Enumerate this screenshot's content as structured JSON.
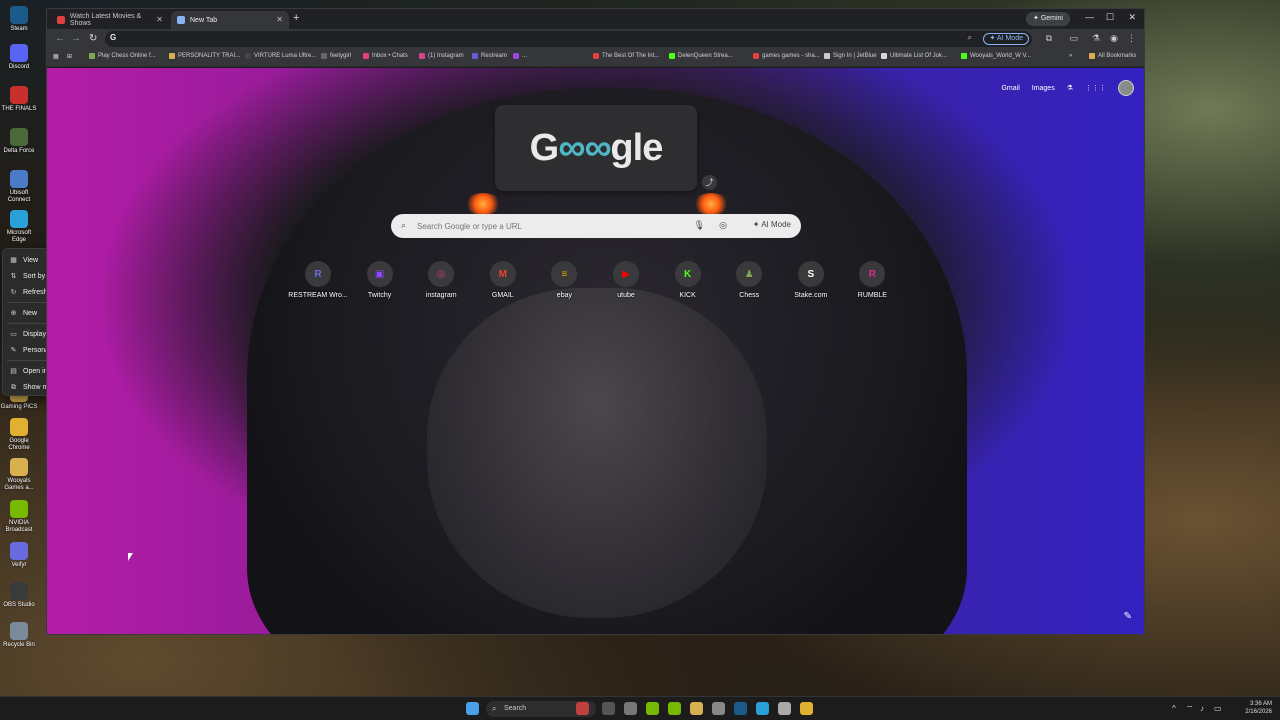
{
  "desktop": {
    "icons": [
      {
        "label": "Steam",
        "color": "#1b5b8a",
        "name": "steam-icon"
      },
      {
        "label": "Discord",
        "color": "#5865f2",
        "name": "discord-icon"
      },
      {
        "label": "THE FINALS",
        "color": "#c9302c",
        "name": "the-finals-icon"
      },
      {
        "label": "Delta Force",
        "color": "#4a6a3a",
        "name": "delta-force-icon"
      },
      {
        "label": "Ubisoft Connect",
        "color": "#4a7ac8",
        "name": "ubisoft-icon"
      },
      {
        "label": "Microsoft Edge",
        "color": "#2aa0d8",
        "name": "edge-icon"
      },
      {
        "label": "Gaming PICS",
        "color": "#d8b050",
        "name": "folder-icon"
      },
      {
        "label": "Google Chrome",
        "color": "#e0b030",
        "name": "chrome-icon"
      },
      {
        "label": "Wooyals Games a...",
        "color": "#d8b050",
        "name": "folder-icon"
      },
      {
        "label": "NVIDIA Broadcast",
        "color": "#76b900",
        "name": "nvidia-icon"
      },
      {
        "label": "Veifyr",
        "color": "#6a6ae0",
        "name": "app-icon"
      },
      {
        "label": "OBS Studio",
        "color": "#3a3a3a",
        "name": "obs-icon"
      },
      {
        "label": "Recycle Bin",
        "color": "#7a8a9a",
        "name": "recycle-bin-icon"
      }
    ]
  },
  "context_menu": {
    "items": [
      {
        "label": "View",
        "icon": "▦",
        "arrow": true
      },
      {
        "label": "Sort by",
        "icon": "⇅",
        "arrow": true
      },
      {
        "label": "Refresh",
        "icon": "↻",
        "arrow": false
      },
      {
        "label": "New",
        "icon": "⊕",
        "arrow": true
      },
      {
        "label": "Display settings",
        "icon": "▭",
        "arrow": false
      },
      {
        "label": "Personalize",
        "icon": "✎",
        "arrow": false
      },
      {
        "label": "Open in Terminal",
        "icon": "▤",
        "arrow": false
      },
      {
        "label": "Show more options",
        "icon": "⧉",
        "arrow": false
      }
    ]
  },
  "browser": {
    "tabs": [
      {
        "title": "Watch Latest Movies & Shows",
        "favicon_color": "#e04040"
      },
      {
        "title": "New Tab",
        "favicon_color": "#8ab4f8"
      }
    ],
    "gemini_label": "Gemini",
    "omnibox_value": "",
    "ai_mode_top": "AI Mode",
    "bookmarks": [
      {
        "label": "Play Chess Online f...",
        "color": "#7fa650"
      },
      {
        "label": "PERSONALITY TRAI...",
        "color": "#d8b050"
      },
      {
        "label": "VIRTURE Luma Ultre...",
        "color": "#444444"
      },
      {
        "label": "feetygirl",
        "color": "#666666"
      },
      {
        "label": "Inbox • Chats",
        "color": "#e04080"
      },
      {
        "label": "(1) Instagram",
        "color": "#d84090"
      },
      {
        "label": "Restream",
        "color": "#6a5ae0"
      },
      {
        "label": "...",
        "color": "#9a4ae0"
      },
      {
        "label": "The Best Of The Int...",
        "color": "#e04040"
      },
      {
        "label": "DelenQueen Strea...",
        "color": "#53fc18"
      },
      {
        "label": "games games - sha...",
        "color": "#e04040"
      },
      {
        "label": "Sign In | JetBlue",
        "color": "#cccccc"
      },
      {
        "label": "Ultimate List Of Jok...",
        "color": "#d8d8d8"
      },
      {
        "label": "Wooyals_World_W V...",
        "color": "#53fc18"
      }
    ],
    "all_bookmarks": "All Bookmarks"
  },
  "newtab": {
    "top_links": {
      "gmail": "Gmail",
      "images": "Images"
    },
    "doodle_left": "G",
    "doodle_right": "gle",
    "search_placeholder": "Search Google or type a URL",
    "ai_mode": "AI Mode",
    "shortcuts": [
      {
        "label": "RESTREAM Wro...",
        "glyph": "R",
        "color": "#6a6ae0"
      },
      {
        "label": "Twitchy",
        "glyph": "▣",
        "color": "#9146ff"
      },
      {
        "label": "instagram",
        "glyph": "◎",
        "color": "#d8308a"
      },
      {
        "label": "GMAIL",
        "glyph": "M",
        "color": "#ea4335"
      },
      {
        "label": "ebay",
        "glyph": "≡",
        "color": "#e5a000"
      },
      {
        "label": "utube",
        "glyph": "▶",
        "color": "#ff0000"
      },
      {
        "label": "KICK",
        "glyph": "K",
        "color": "#53fc18"
      },
      {
        "label": "Chess",
        "glyph": "♟",
        "color": "#7fa650"
      },
      {
        "label": "Stake.com",
        "glyph": "S",
        "color": "#ffffff"
      },
      {
        "label": "RUMBLE",
        "glyph": "R",
        "color": "#d8308a"
      }
    ]
  },
  "taskbar": {
    "search_label": "Search",
    "time": "3:36 AM",
    "date": "2/16/2026"
  }
}
